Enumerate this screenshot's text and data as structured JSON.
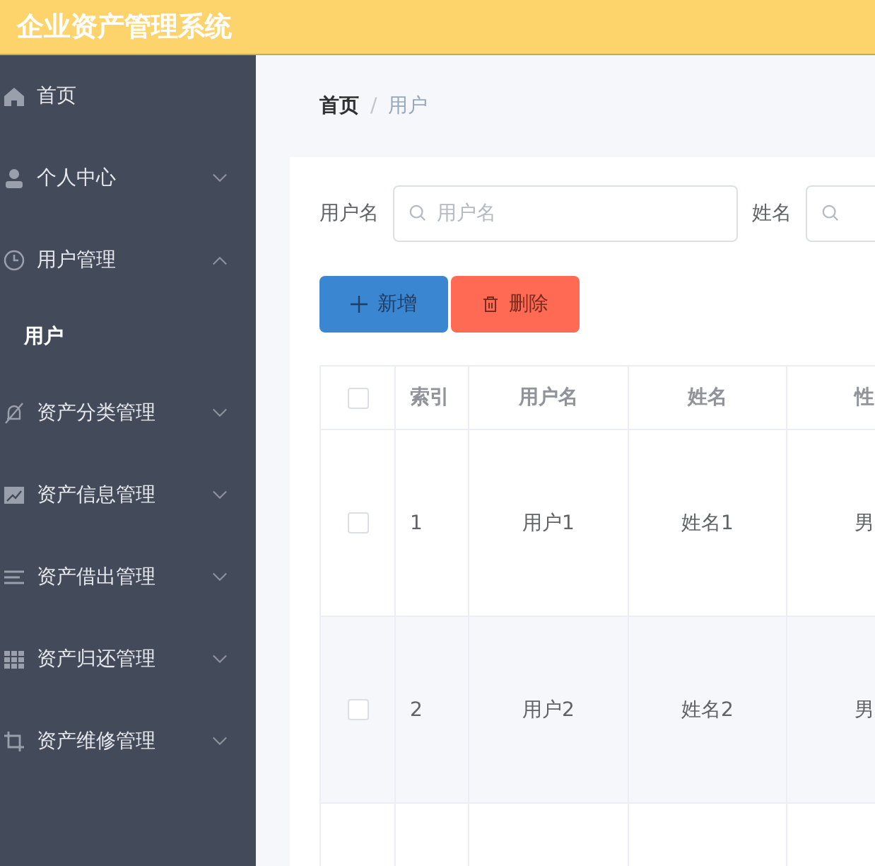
{
  "header": {
    "title": "企业资产管理系统"
  },
  "sidebar": {
    "items": [
      {
        "kind": "link",
        "label": "首页",
        "selected": false
      },
      {
        "kind": "submenu",
        "label": "个人中心",
        "expanded": false
      },
      {
        "kind": "submenu",
        "label": "用户管理",
        "expanded": true,
        "children": [
          {
            "label": "用户",
            "selected": true
          }
        ]
      },
      {
        "kind": "submenu",
        "label": "资产分类管理",
        "expanded": false
      },
      {
        "kind": "submenu",
        "label": "资产信息管理",
        "expanded": false
      },
      {
        "kind": "submenu",
        "label": "资产借出管理",
        "expanded": false
      },
      {
        "kind": "submenu",
        "label": "资产归还管理",
        "expanded": false
      },
      {
        "kind": "submenu",
        "label": "资产维修管理",
        "expanded": false
      }
    ]
  },
  "breadcrumb": {
    "separator": "/",
    "items": [
      "首页",
      "用户"
    ]
  },
  "search": [
    {
      "label": "用户名",
      "placeholder": "用户名"
    },
    {
      "label": "姓名"
    }
  ],
  "buttons": [
    {
      "kind": "add",
      "label": "新增"
    },
    {
      "kind": "delete",
      "label": "删除"
    }
  ],
  "table": {
    "columns": [
      "索引",
      "用户名",
      "姓名",
      "性"
    ],
    "rows": [
      {
        "checked": false,
        "cells": [
          "1",
          "用户1",
          "姓名1",
          "男"
        ]
      },
      {
        "checked": false,
        "cells": [
          "2",
          "用户2",
          "姓名2",
          "男"
        ]
      }
    ],
    "header_checked": false
  }
}
